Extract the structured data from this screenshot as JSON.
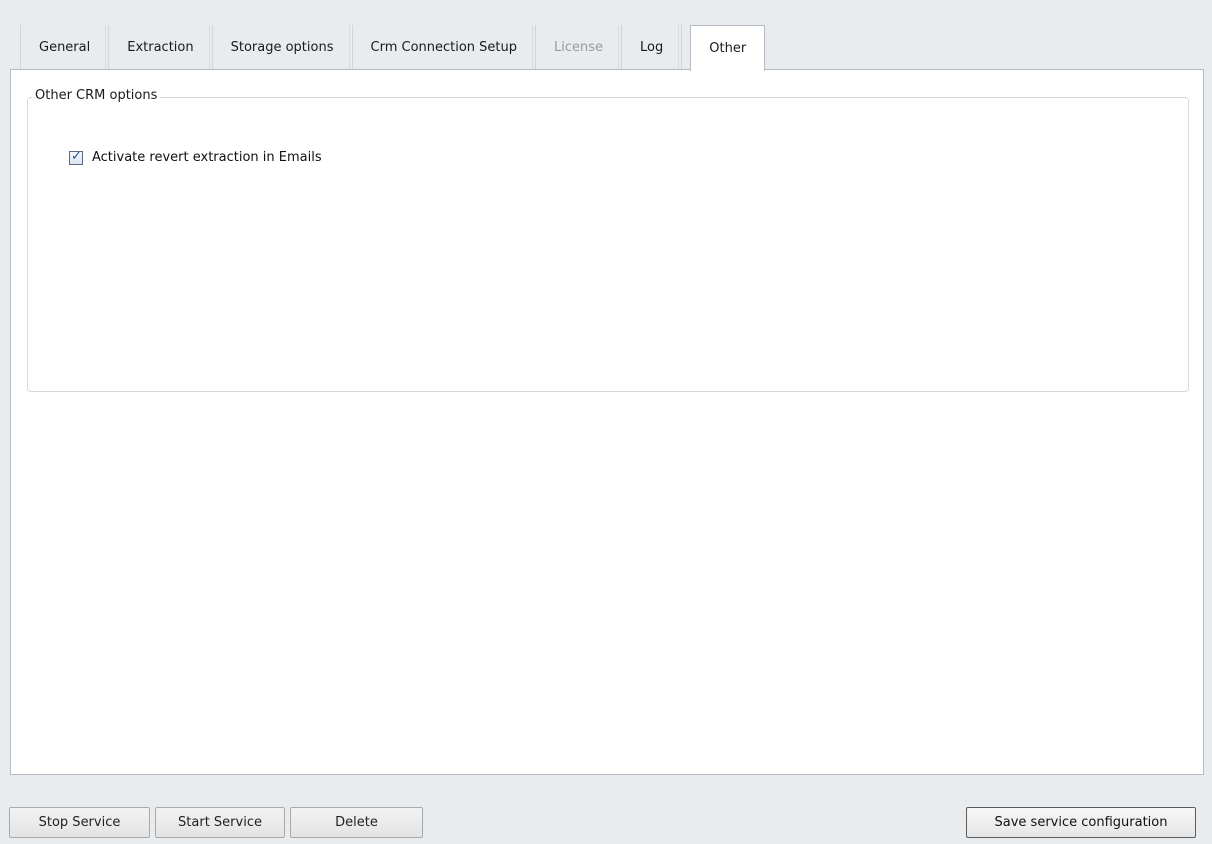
{
  "tabs": [
    {
      "label": "General",
      "state": "normal"
    },
    {
      "label": "Extraction",
      "state": "normal"
    },
    {
      "label": "Storage options",
      "state": "normal"
    },
    {
      "label": "Crm Connection Setup",
      "state": "normal"
    },
    {
      "label": "License",
      "state": "disabled"
    },
    {
      "label": "Log",
      "state": "normal"
    },
    {
      "label": "Other",
      "state": "active"
    }
  ],
  "panel": {
    "group_title": "Other CRM options",
    "checkbox": {
      "label": "Activate revert extraction in Emails",
      "checked": true
    }
  },
  "buttons": {
    "stop_service": "Stop Service",
    "start_service": "Start Service",
    "delete": "Delete",
    "save_configuration": "Save service configuration"
  },
  "colors": {
    "window_bg": "#e9ecee",
    "panel_bg": "#ffffff",
    "disabled_text": "#9a9a9a",
    "checkmark": "#2a4f8f"
  }
}
